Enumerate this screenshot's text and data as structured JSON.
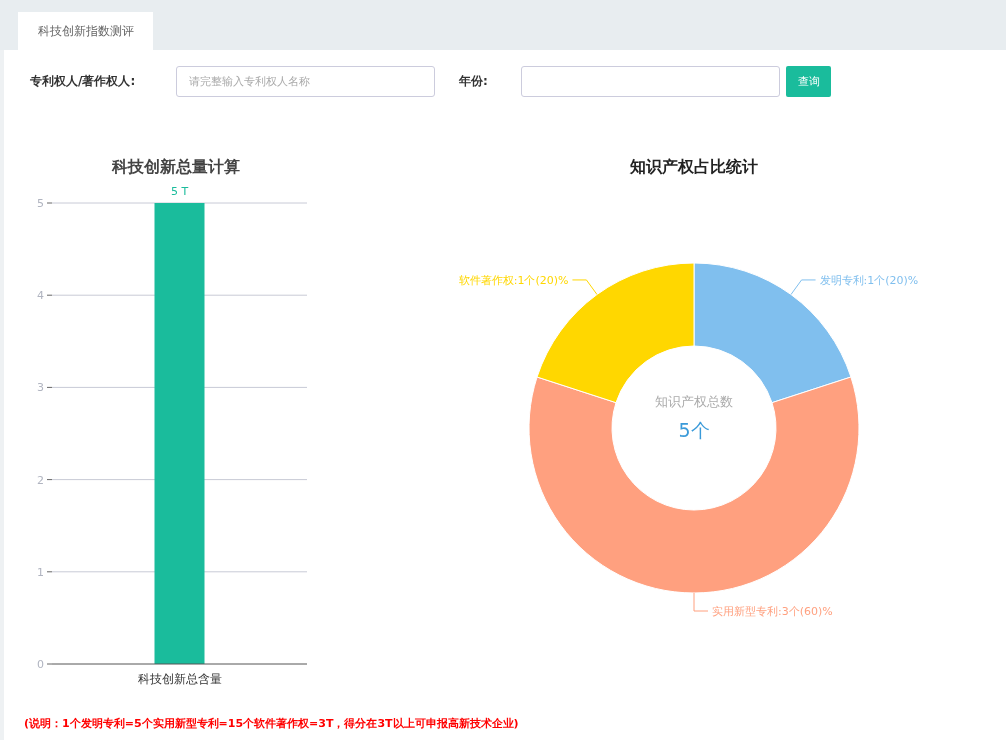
{
  "tabs": [
    {
      "label": "科技创新指数测评",
      "selected": true
    }
  ],
  "filters": {
    "owner_label": "专利权人/著作权人:",
    "owner_placeholder": "请完整输入专利权人名称",
    "year_label": "年份:",
    "search_button": "查询"
  },
  "bar_panel": {
    "chart_data": {
      "type": "bar",
      "title": "科技创新总量计算",
      "categories": [
        "科技创新总含量"
      ],
      "values": [
        5
      ],
      "ylim": [
        0,
        5
      ],
      "yticks": [
        0,
        1,
        2,
        3,
        4,
        5
      ],
      "grid": true,
      "value_labels": [
        "5 T"
      ],
      "colors": [
        "#1abc9c"
      ]
    }
  },
  "pie_panel": {
    "center_title": "知识产权总数",
    "center_value": "5个",
    "chart_data": {
      "type": "donut",
      "title": "知识产权占比统计",
      "categories": [
        "发明专利",
        "实用新型专利",
        "软件著作权"
      ],
      "values": [
        1,
        3,
        1
      ],
      "value_labels": [
        "1个(20)%",
        "3个(60)%",
        "1个(20)%"
      ],
      "colors": [
        "#80bfee",
        "#ffa07f",
        "#ffd700"
      ]
    }
  },
  "note": "(说明：1个发明专利=5个实用新型专利=15个软件著作权=3T，得分在3T以上可申报高新技术企业)"
}
